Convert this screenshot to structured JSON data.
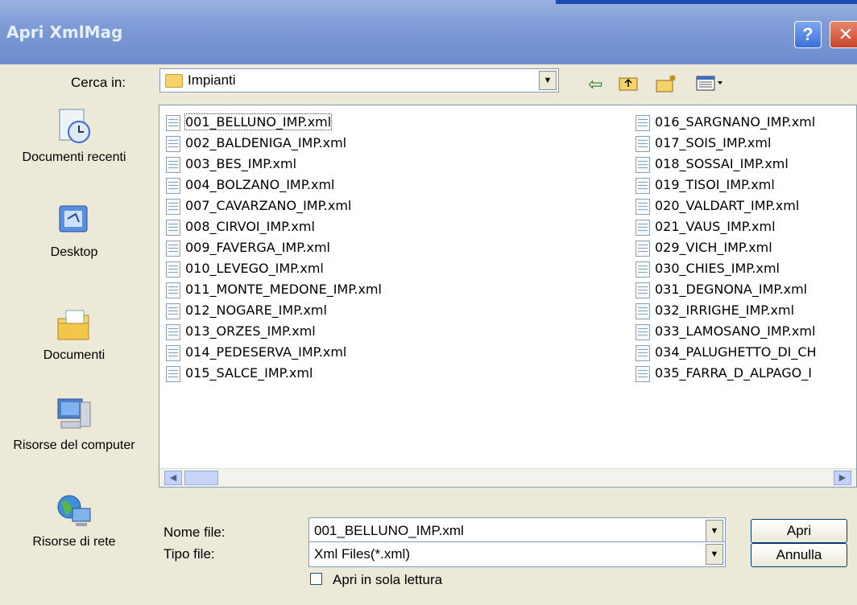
{
  "window": {
    "title": "Apri XmlMag",
    "help_label": "?",
    "close_label": "✕"
  },
  "lookin": {
    "label": "Cerca in:",
    "value": "Impianti",
    "icon": "folder-icon"
  },
  "toolbar": {
    "icons": [
      "back-arrow-icon",
      "up-folder-icon",
      "new-folder-icon",
      "view-menu-icon"
    ]
  },
  "places": [
    {
      "label": "Documenti recenti",
      "icon": "recent-documents-icon"
    },
    {
      "label": "Desktop",
      "icon": "desktop-icon"
    },
    {
      "label": "Documenti",
      "icon": "my-documents-icon"
    },
    {
      "label": "Risorse del computer",
      "icon": "my-computer-icon"
    },
    {
      "label": "Risorse di rete",
      "icon": "network-icon"
    }
  ],
  "files_col1": [
    "001_BELLUNO_IMP.xml",
    "002_BALDENIGA_IMP.xml",
    "003_BES_IMP.xml",
    "004_BOLZANO_IMP.xml",
    "007_CAVARZANO_IMP.xml",
    "008_CIRVOI_IMP.xml",
    "009_FAVERGA_IMP.xml",
    "010_LEVEGO_IMP.xml",
    "011_MONTE_MEDONE_IMP.xml",
    "012_NOGARE_IMP.xml",
    "013_ORZES_IMP.xml",
    "014_PEDESERVA_IMP.xml",
    "015_SALCE_IMP.xml"
  ],
  "files_col2": [
    "016_SARGNANO_IMP.xml",
    "017_SOIS_IMP.xml",
    "018_SOSSAI_IMP.xml",
    "019_TISOI_IMP.xml",
    "020_VALDART_IMP.xml",
    "021_VAUS_IMP.xml",
    "029_VICH_IMP.xml",
    "030_CHIES_IMP.xml",
    "031_DEGNONA_IMP.xml",
    "032_IRRIGHE_IMP.xml",
    "033_LAMOSANO_IMP.xml",
    "034_PALUGHETTO_DI_CH",
    "035_FARRA_D_ALPAGO_I"
  ],
  "filename": {
    "label": "Nome file:",
    "value": "001_BELLUNO_IMP.xml"
  },
  "filetype": {
    "label": "Tipo file:",
    "value": "Xml Files(*.xml)"
  },
  "buttons": {
    "open": "Apri",
    "cancel": "Annulla"
  },
  "readonly": {
    "label": "Apri in sola lettura",
    "checked": false
  }
}
